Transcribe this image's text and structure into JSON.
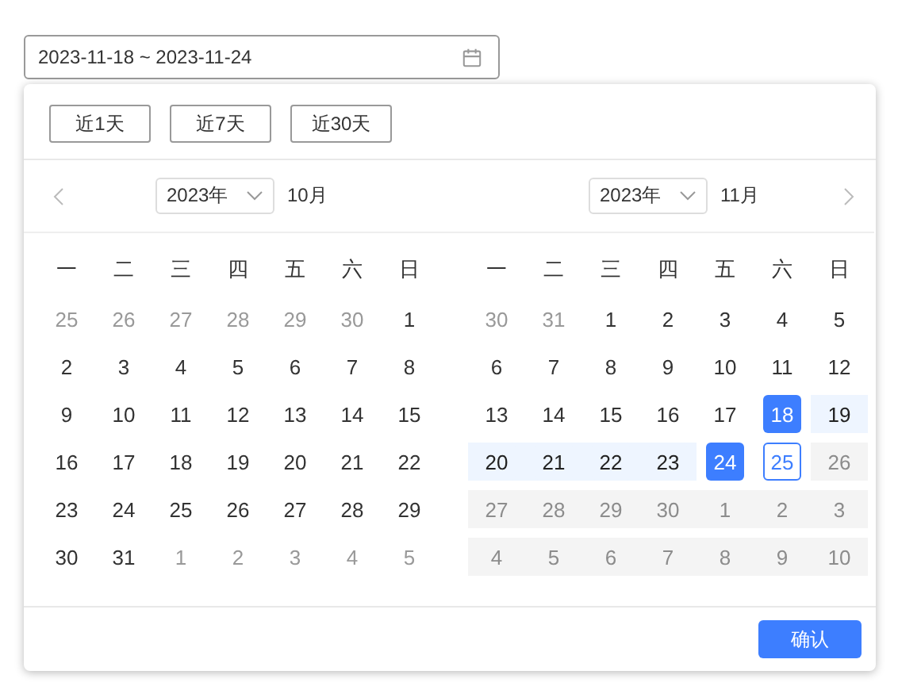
{
  "date_range_input": {
    "value": "2023-11-18 ~ 2023-11-24"
  },
  "shortcuts": [
    "近1天",
    "近7天",
    "近30天"
  ],
  "months": [
    {
      "year": "2023年",
      "month": "10月",
      "weekdays": [
        "一",
        "二",
        "三",
        "四",
        "五",
        "六",
        "日"
      ],
      "weeks": [
        [
          {
            "day": "25",
            "kind": "muted",
            "selected": false,
            "in_range": false,
            "focused": false
          },
          {
            "day": "26",
            "kind": "muted",
            "selected": false,
            "in_range": false,
            "focused": false
          },
          {
            "day": "27",
            "kind": "muted",
            "selected": false,
            "in_range": false,
            "focused": false
          },
          {
            "day": "28",
            "kind": "muted",
            "selected": false,
            "in_range": false,
            "focused": false
          },
          {
            "day": "29",
            "kind": "muted",
            "selected": false,
            "in_range": false,
            "focused": false
          },
          {
            "day": "30",
            "kind": "muted",
            "selected": false,
            "in_range": false,
            "focused": false
          },
          {
            "day": "1",
            "kind": "normal",
            "selected": false,
            "in_range": false,
            "focused": false
          }
        ],
        [
          {
            "day": "2",
            "kind": "normal",
            "selected": false,
            "in_range": false,
            "focused": false
          },
          {
            "day": "3",
            "kind": "normal",
            "selected": false,
            "in_range": false,
            "focused": false
          },
          {
            "day": "4",
            "kind": "normal",
            "selected": false,
            "in_range": false,
            "focused": false
          },
          {
            "day": "5",
            "kind": "normal",
            "selected": false,
            "in_range": false,
            "focused": false
          },
          {
            "day": "6",
            "kind": "normal",
            "selected": false,
            "in_range": false,
            "focused": false
          },
          {
            "day": "7",
            "kind": "normal",
            "selected": false,
            "in_range": false,
            "focused": false
          },
          {
            "day": "8",
            "kind": "normal",
            "selected": false,
            "in_range": false,
            "focused": false
          }
        ],
        [
          {
            "day": "9",
            "kind": "normal",
            "selected": false,
            "in_range": false,
            "focused": false
          },
          {
            "day": "10",
            "kind": "normal",
            "selected": false,
            "in_range": false,
            "focused": false
          },
          {
            "day": "11",
            "kind": "normal",
            "selected": false,
            "in_range": false,
            "focused": false
          },
          {
            "day": "12",
            "kind": "normal",
            "selected": false,
            "in_range": false,
            "focused": false
          },
          {
            "day": "13",
            "kind": "normal",
            "selected": false,
            "in_range": false,
            "focused": false
          },
          {
            "day": "14",
            "kind": "normal",
            "selected": false,
            "in_range": false,
            "focused": false
          },
          {
            "day": "15",
            "kind": "normal",
            "selected": false,
            "in_range": false,
            "focused": false
          }
        ],
        [
          {
            "day": "16",
            "kind": "normal",
            "selected": false,
            "in_range": false,
            "focused": false
          },
          {
            "day": "17",
            "kind": "normal",
            "selected": false,
            "in_range": false,
            "focused": false
          },
          {
            "day": "18",
            "kind": "normal",
            "selected": false,
            "in_range": false,
            "focused": false
          },
          {
            "day": "19",
            "kind": "normal",
            "selected": false,
            "in_range": false,
            "focused": false
          },
          {
            "day": "20",
            "kind": "normal",
            "selected": false,
            "in_range": false,
            "focused": false
          },
          {
            "day": "21",
            "kind": "normal",
            "selected": false,
            "in_range": false,
            "focused": false
          },
          {
            "day": "22",
            "kind": "normal",
            "selected": false,
            "in_range": false,
            "focused": false
          }
        ],
        [
          {
            "day": "23",
            "kind": "normal",
            "selected": false,
            "in_range": false,
            "focused": false
          },
          {
            "day": "24",
            "kind": "normal",
            "selected": false,
            "in_range": false,
            "focused": false
          },
          {
            "day": "25",
            "kind": "normal",
            "selected": false,
            "in_range": false,
            "focused": false
          },
          {
            "day": "26",
            "kind": "normal",
            "selected": false,
            "in_range": false,
            "focused": false
          },
          {
            "day": "27",
            "kind": "normal",
            "selected": false,
            "in_range": false,
            "focused": false
          },
          {
            "day": "28",
            "kind": "normal",
            "selected": false,
            "in_range": false,
            "focused": false
          },
          {
            "day": "29",
            "kind": "normal",
            "selected": false,
            "in_range": false,
            "focused": false
          }
        ],
        [
          {
            "day": "30",
            "kind": "normal",
            "selected": false,
            "in_range": false,
            "focused": false
          },
          {
            "day": "31",
            "kind": "normal",
            "selected": false,
            "in_range": false,
            "focused": false
          },
          {
            "day": "1",
            "kind": "muted",
            "selected": false,
            "in_range": false,
            "focused": false
          },
          {
            "day": "2",
            "kind": "muted",
            "selected": false,
            "in_range": false,
            "focused": false
          },
          {
            "day": "3",
            "kind": "muted",
            "selected": false,
            "in_range": false,
            "focused": false
          },
          {
            "day": "4",
            "kind": "muted",
            "selected": false,
            "in_range": false,
            "focused": false
          },
          {
            "day": "5",
            "kind": "muted",
            "selected": false,
            "in_range": false,
            "focused": false
          }
        ]
      ]
    },
    {
      "year": "2023年",
      "month": "11月",
      "weekdays": [
        "一",
        "二",
        "三",
        "四",
        "五",
        "六",
        "日"
      ],
      "weeks": [
        [
          {
            "day": "30",
            "kind": "muted",
            "selected": false,
            "in_range": false,
            "focused": false
          },
          {
            "day": "31",
            "kind": "muted",
            "selected": false,
            "in_range": false,
            "focused": false
          },
          {
            "day": "1",
            "kind": "normal",
            "selected": false,
            "in_range": false,
            "focused": false
          },
          {
            "day": "2",
            "kind": "normal",
            "selected": false,
            "in_range": false,
            "focused": false
          },
          {
            "day": "3",
            "kind": "normal",
            "selected": false,
            "in_range": false,
            "focused": false
          },
          {
            "day": "4",
            "kind": "normal",
            "selected": false,
            "in_range": false,
            "focused": false
          },
          {
            "day": "5",
            "kind": "normal",
            "selected": false,
            "in_range": false,
            "focused": false
          }
        ],
        [
          {
            "day": "6",
            "kind": "normal",
            "selected": false,
            "in_range": false,
            "focused": false
          },
          {
            "day": "7",
            "kind": "normal",
            "selected": false,
            "in_range": false,
            "focused": false
          },
          {
            "day": "8",
            "kind": "normal",
            "selected": false,
            "in_range": false,
            "focused": false
          },
          {
            "day": "9",
            "kind": "normal",
            "selected": false,
            "in_range": false,
            "focused": false
          },
          {
            "day": "10",
            "kind": "normal",
            "selected": false,
            "in_range": false,
            "focused": false
          },
          {
            "day": "11",
            "kind": "normal",
            "selected": false,
            "in_range": false,
            "focused": false
          },
          {
            "day": "12",
            "kind": "normal",
            "selected": false,
            "in_range": false,
            "focused": false
          }
        ],
        [
          {
            "day": "13",
            "kind": "normal",
            "selected": false,
            "in_range": false,
            "focused": false
          },
          {
            "day": "14",
            "kind": "normal",
            "selected": false,
            "in_range": false,
            "focused": false
          },
          {
            "day": "15",
            "kind": "normal",
            "selected": false,
            "in_range": false,
            "focused": false
          },
          {
            "day": "16",
            "kind": "normal",
            "selected": false,
            "in_range": false,
            "focused": false
          },
          {
            "day": "17",
            "kind": "normal",
            "selected": false,
            "in_range": false,
            "focused": false
          },
          {
            "day": "18",
            "kind": "normal",
            "selected": true,
            "in_range": false,
            "focused": false
          },
          {
            "day": "19",
            "kind": "normal",
            "selected": false,
            "in_range": true,
            "focused": false
          }
        ],
        [
          {
            "day": "20",
            "kind": "normal",
            "selected": false,
            "in_range": true,
            "focused": false
          },
          {
            "day": "21",
            "kind": "normal",
            "selected": false,
            "in_range": true,
            "focused": false
          },
          {
            "day": "22",
            "kind": "normal",
            "selected": false,
            "in_range": true,
            "focused": false
          },
          {
            "day": "23",
            "kind": "normal",
            "selected": false,
            "in_range": true,
            "focused": false
          },
          {
            "day": "24",
            "kind": "normal",
            "selected": true,
            "in_range": false,
            "focused": false
          },
          {
            "day": "25",
            "kind": "normal",
            "selected": false,
            "in_range": false,
            "focused": true
          },
          {
            "day": "26",
            "kind": "disabled",
            "selected": false,
            "in_range": false,
            "focused": false
          }
        ],
        [
          {
            "day": "27",
            "kind": "disabled",
            "selected": false,
            "in_range": false,
            "focused": false
          },
          {
            "day": "28",
            "kind": "disabled",
            "selected": false,
            "in_range": false,
            "focused": false
          },
          {
            "day": "29",
            "kind": "disabled",
            "selected": false,
            "in_range": false,
            "focused": false
          },
          {
            "day": "30",
            "kind": "disabled",
            "selected": false,
            "in_range": false,
            "focused": false
          },
          {
            "day": "1",
            "kind": "disabled",
            "selected": false,
            "in_range": false,
            "focused": false
          },
          {
            "day": "2",
            "kind": "disabled",
            "selected": false,
            "in_range": false,
            "focused": false
          },
          {
            "day": "3",
            "kind": "disabled",
            "selected": false,
            "in_range": false,
            "focused": false
          }
        ],
        [
          {
            "day": "4",
            "kind": "disabled",
            "selected": false,
            "in_range": false,
            "focused": false
          },
          {
            "day": "5",
            "kind": "disabled",
            "selected": false,
            "in_range": false,
            "focused": false
          },
          {
            "day": "6",
            "kind": "disabled",
            "selected": false,
            "in_range": false,
            "focused": false
          },
          {
            "day": "7",
            "kind": "disabled",
            "selected": false,
            "in_range": false,
            "focused": false
          },
          {
            "day": "8",
            "kind": "disabled",
            "selected": false,
            "in_range": false,
            "focused": false
          },
          {
            "day": "9",
            "kind": "disabled",
            "selected": false,
            "in_range": false,
            "focused": false
          },
          {
            "day": "10",
            "kind": "disabled",
            "selected": false,
            "in_range": false,
            "focused": false
          }
        ]
      ]
    }
  ],
  "confirm_button": "确认"
}
